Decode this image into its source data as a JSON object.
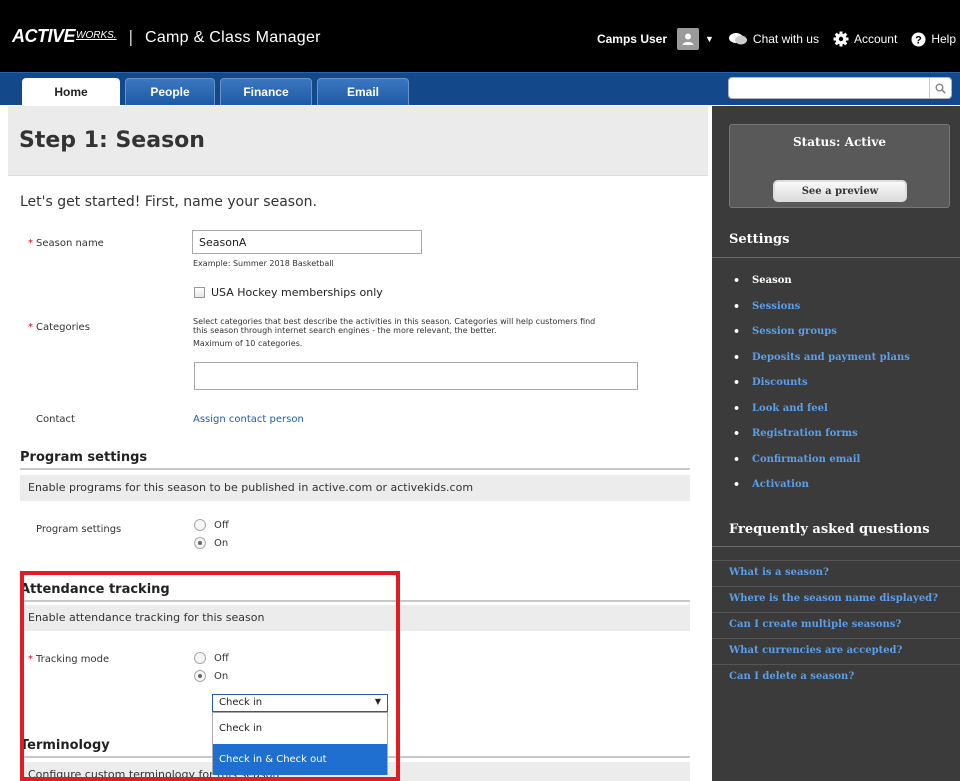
{
  "header": {
    "logo": "ACTIVE",
    "logo_sub": "WORKS.",
    "separator": "|",
    "app_title": "Camp & Class Manager",
    "user_name": "Camps User",
    "chat_label": "Chat with us",
    "account_label": "Account",
    "help_label": "Help"
  },
  "nav": {
    "tabs": [
      {
        "label": "Home",
        "active": true
      },
      {
        "label": "People",
        "active": false
      },
      {
        "label": "Finance",
        "active": false
      },
      {
        "label": "Email",
        "active": false
      }
    ],
    "search_value": ""
  },
  "main": {
    "page_title": "Step 1: Season",
    "intro": "Let's get started! First, name your season.",
    "season_name": {
      "label": "Season name",
      "value": "SeasonA",
      "example": "Example: Summer 2018 Basketball",
      "checkbox_label": "USA Hockey memberships only"
    },
    "categories": {
      "label": "Categories",
      "help_line1": "Select categories that best describe the activities in this season. Categories will help customers find",
      "help_line2": "this season through internet search engines - the more relevant, the better.",
      "max": "Maximum of 10 categories.",
      "value": ""
    },
    "contact": {
      "label": "Contact",
      "link": "Assign contact person"
    },
    "program_settings": {
      "title": "Program settings",
      "description": "Enable programs for this season to be published in active.com or activekids.com",
      "field_label": "Program settings",
      "off_label": "Off",
      "on_label": "On",
      "selected": "On"
    },
    "attendance": {
      "title": "Attendance tracking",
      "description": "Enable attendance tracking for this season",
      "field_label": "Tracking mode",
      "off_label": "Off",
      "on_label": "On",
      "selected": "On",
      "select_value": "Check in",
      "options": [
        "Check in",
        "Check in & Check out"
      ],
      "highlighted_option": "Check in & Check out"
    },
    "terminology": {
      "title": "Terminology",
      "description": "Configure custom terminology for this season"
    }
  },
  "sidebar": {
    "status": "Status: Active",
    "preview_button": "See a preview",
    "settings_heading": "Settings",
    "settings_items": [
      {
        "label": "Season",
        "current": true
      },
      {
        "label": "Sessions",
        "current": false
      },
      {
        "label": "Session groups",
        "current": false
      },
      {
        "label": "Deposits and payment plans",
        "current": false
      },
      {
        "label": "Discounts",
        "current": false
      },
      {
        "label": "Look and feel",
        "current": false
      },
      {
        "label": "Registration forms",
        "current": false
      },
      {
        "label": "Confirmation email",
        "current": false
      },
      {
        "label": "Activation",
        "current": false
      }
    ],
    "faq_heading": "Frequently asked questions",
    "faq_items": [
      "What is a season?",
      "Where is the season name displayed?",
      "Can I create multiple seasons?",
      "What currencies are accepted?",
      "Can I delete a season?"
    ]
  },
  "colors": {
    "nav_blue": "#13488a",
    "link_blue": "#1f5fa8",
    "highlight_red": "#e31b23",
    "sidebar_dark": "#3b3b3b",
    "selected_option": "#1e6fd0"
  },
  "icons": [
    "user-icon",
    "chevron-down-icon",
    "chat-icon",
    "gear-icon",
    "help-icon",
    "search-icon"
  ]
}
